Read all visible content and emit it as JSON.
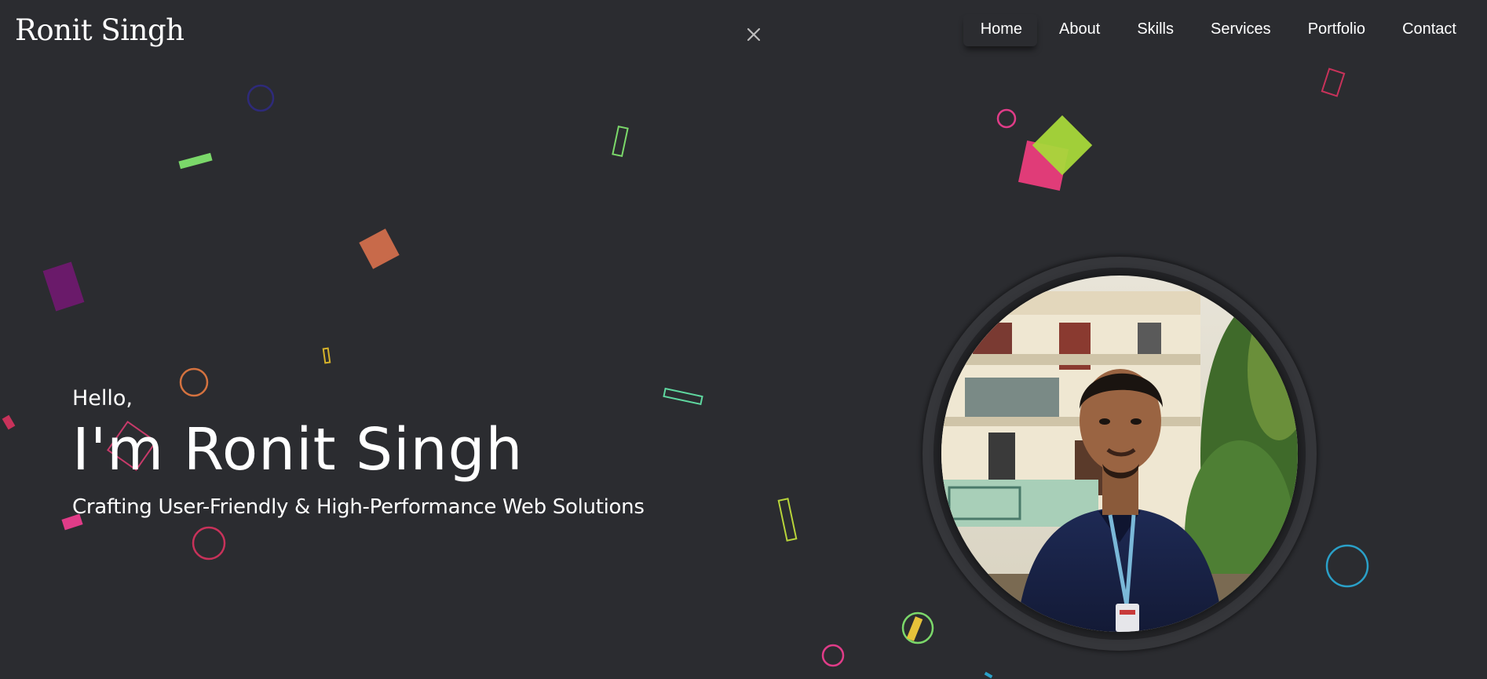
{
  "header": {
    "logo": "Ronit Singh",
    "nav": [
      {
        "label": "Home",
        "active": true
      },
      {
        "label": "About",
        "active": false
      },
      {
        "label": "Skills",
        "active": false
      },
      {
        "label": "Services",
        "active": false
      },
      {
        "label": "Portfolio",
        "active": false
      },
      {
        "label": "Contact",
        "active": false
      }
    ],
    "close_icon": "close-icon"
  },
  "hero": {
    "greeting": "Hello,",
    "name": "I'm Ronit Singh",
    "tagline": "Crafting User-Friendly & High-Performance Web Solutions"
  },
  "profile": {
    "icon": "profile-photo"
  },
  "colors": {
    "background": "#2b2c30",
    "text": "#ffffff"
  }
}
